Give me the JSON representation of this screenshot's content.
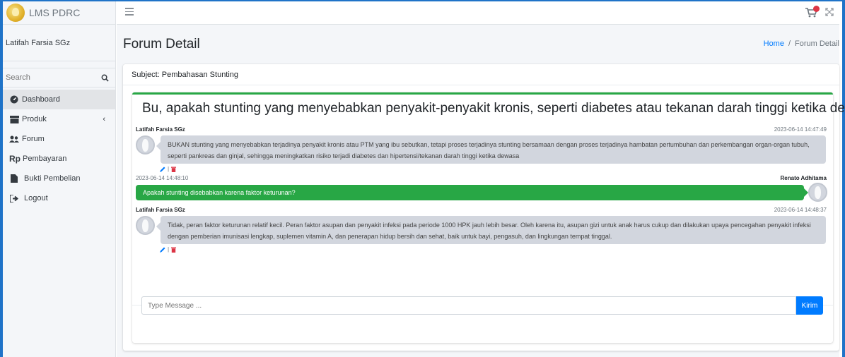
{
  "brand": {
    "name": "LMS PDRC"
  },
  "user": {
    "name": "Latifah Farsia SGz"
  },
  "search": {
    "placeholder": "Search"
  },
  "nav": {
    "items": [
      {
        "label": "Dashboard",
        "icon": "dashboard-icon"
      },
      {
        "label": "Produk",
        "icon": "product-icon"
      },
      {
        "label": "Forum",
        "icon": "forum-icon"
      },
      {
        "label": "Pembayaran",
        "icon": "payment-icon"
      },
      {
        "label": "Bukti Pembelian",
        "icon": "receipt-icon"
      },
      {
        "label": "Logout",
        "icon": "logout-icon"
      }
    ]
  },
  "header": {
    "title": "Forum Detail",
    "breadcrumb": {
      "home": "Home",
      "separator": "/",
      "current": "Forum Detail"
    }
  },
  "forum": {
    "subject": "Subject: Pembahasan Stunting",
    "question": "Bu, apakah stunting yang menyebabkan penyakit-penyakit kronis, seperti diabetes atau tekanan darah tinggi ketika dewasa?",
    "messages": [
      {
        "author": "Latifah Farsia SGz",
        "time": "2023-06-14 14:47:49",
        "text": "BUKAN stunting yang menyebabkan terjadinya penyakit kronis atau PTM yang ibu sebutkan, tetapi proses terjadinya stunting bersamaan dengan proses terjadinya hambatan pertumbuhan dan perkembangan organ-organ tubuh, seperti pankreas dan ginjal, sehingga meningkatkan risiko terjadi diabetes dan hipertensi/tekanan darah tinggi ketika dewasa"
      },
      {
        "author": "Renato Adhitama",
        "time": "2023-06-14 14:48:10",
        "text": "Apakah stunting disebabkan karena faktor keturunan?"
      },
      {
        "author": "Latifah Farsia SGz",
        "time": "2023-06-14 14:48:37",
        "text": "Tidak, peran faktor keturunan relatif kecil. Peran faktor asupan dan penyakit infeksi pada periode 1000 HPK jauh lebih besar. Oleh karena itu, asupan gizi untuk anak harus cukup dan dilakukan upaya pencegahan penyakit infeksi dengan pemberian imunisasi lengkap, suplemen vitamin A, dan penerapan hidup bersih dan sehat, baik untuk bayi, pengasuh, dan lingkungan tempat tinggal."
      }
    ],
    "action_separator": "|",
    "input_placeholder": "Type Message ...",
    "send_label": "Kirim"
  },
  "colors": {
    "accent_blue": "#007bff",
    "accent_green": "#28a745",
    "danger_red": "#dc3545",
    "bubble_grey": "#d2d6de"
  }
}
